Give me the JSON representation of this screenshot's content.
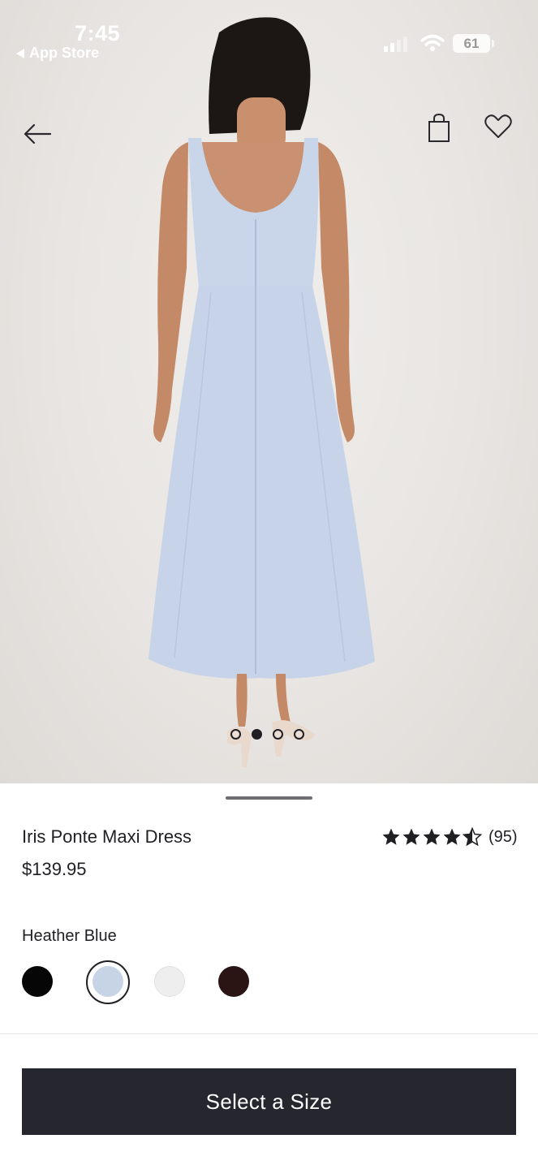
{
  "status_bar": {
    "time": "7:45",
    "back_app_label": "App Store",
    "battery_level": "61"
  },
  "nav": {
    "back_icon": "arrow-left-icon",
    "bag_icon": "shopping-bag-icon",
    "favorite_icon": "heart-outline-icon"
  },
  "gallery": {
    "image_count": 4,
    "active_index": 1
  },
  "product": {
    "name": "Iris Ponte Maxi Dress",
    "price": "$139.95",
    "rating_value": 4.5,
    "rating_count": "(95)"
  },
  "color": {
    "selected_label": "Heather Blue",
    "swatches": [
      {
        "name": "Black",
        "hex": "#060606"
      },
      {
        "name": "Heather Blue",
        "hex": "#c6d4e6"
      },
      {
        "name": "White",
        "hex": "#eeeeee"
      },
      {
        "name": "Brown",
        "hex": "#2a1514"
      }
    ],
    "selected_index": 1
  },
  "cta": {
    "label": "Select a Size"
  },
  "colors": {
    "primary_dark": "#26262e",
    "text": "#1f1f24",
    "dress": "#c9d6ea"
  }
}
